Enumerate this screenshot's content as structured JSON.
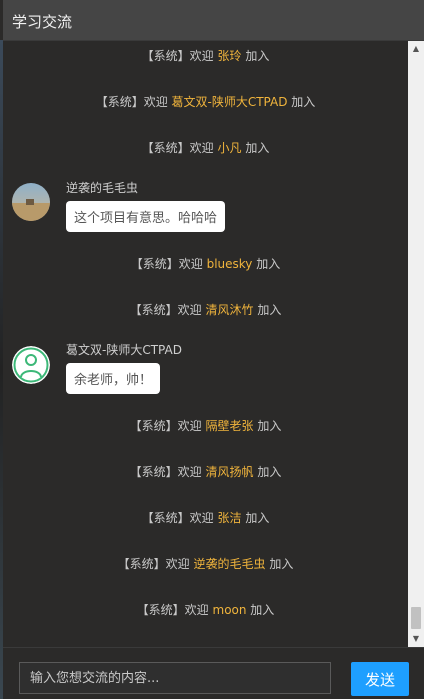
{
  "header": {
    "title": "学习交流"
  },
  "messages": [
    {
      "type": "system",
      "prefix": "【系统】欢迎 ",
      "user": "张玲",
      "suffix": " 加入"
    },
    {
      "type": "system",
      "prefix": "【系统】欢迎 ",
      "user": "葛文双-陕师大CTPAD",
      "suffix": " 加入"
    },
    {
      "type": "system",
      "prefix": "【系统】欢迎 ",
      "user": "小凡",
      "suffix": " 加入"
    },
    {
      "type": "chat",
      "sender": "逆袭的毛毛虫",
      "text": "这个项目有意思。哈哈哈",
      "avatar": "photo-avatar"
    },
    {
      "type": "system",
      "prefix": "【系统】欢迎 ",
      "user": "bluesky",
      "suffix": " 加入"
    },
    {
      "type": "system",
      "prefix": "【系统】欢迎 ",
      "user": "清风沐竹",
      "suffix": " 加入"
    },
    {
      "type": "chat",
      "sender": "葛文双-陕师大CTPAD",
      "text": "余老师，帅！",
      "avatar": "default-user-avatar"
    },
    {
      "type": "system",
      "prefix": "【系统】欢迎 ",
      "user": "隔壁老张",
      "suffix": " 加入"
    },
    {
      "type": "system",
      "prefix": "【系统】欢迎 ",
      "user": "清风扬帆",
      "suffix": " 加入"
    },
    {
      "type": "system",
      "prefix": "【系统】欢迎 ",
      "user": "张洁",
      "suffix": " 加入"
    },
    {
      "type": "system",
      "prefix": "【系统】欢迎 ",
      "user": "逆袭的毛毛虫",
      "suffix": " 加入"
    },
    {
      "type": "system",
      "prefix": "【系统】欢迎 ",
      "user": "moon",
      "suffix": " 加入"
    }
  ],
  "composer": {
    "placeholder": "输入您想交流的内容...",
    "send_label": "发送"
  },
  "colors": {
    "background": "#2b2a29",
    "titlebar": "#454545",
    "username_highlight": "#f0b43c",
    "send_button": "#1e9fff",
    "bubble": "#ffffff"
  },
  "icons": {
    "scroll_up": "triangle-up-icon",
    "scroll_down": "triangle-down-icon"
  }
}
